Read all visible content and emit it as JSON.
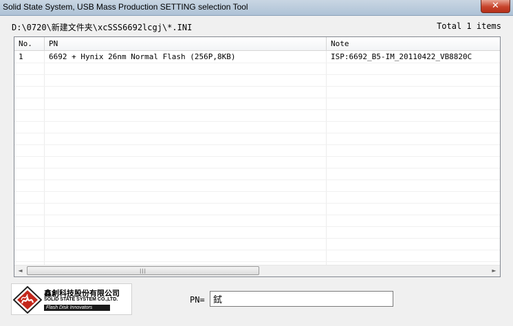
{
  "window": {
    "title": "Solid State System, USB Mass Production SETTING selection Tool",
    "close_label": "✕"
  },
  "path": "D:\\0720\\新建文件夹\\xcSSS6692lcgj\\*.INI",
  "total": "Total 1 items",
  "list": {
    "columns": [
      "No.",
      "PN",
      "Note"
    ],
    "rows": [
      {
        "no": "1",
        "pn": "6692 + Hynix 26nm Normal Flash (256P,8KB)",
        "note": "ISP:6692_B5-IM_20110422_VB8820C"
      }
    ]
  },
  "scrollbar": {
    "left_arrow": "◄",
    "right_arrow": "►",
    "grip": "|||"
  },
  "logo": {
    "company_cn": "鑫創科技股份有限公司",
    "company_en": "SOLID STATE SYSTEM CO.,LTD.",
    "tagline": "Flash Disk Innovators"
  },
  "pn_field": {
    "label": "PN=",
    "value": "鉽"
  }
}
